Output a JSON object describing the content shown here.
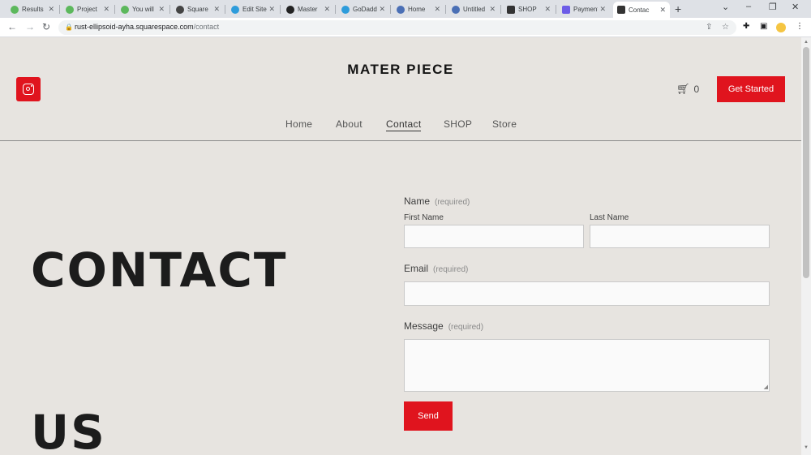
{
  "browser": {
    "tabs": [
      {
        "title": "Results",
        "favicon_color": "#5cb85c"
      },
      {
        "title": "Project",
        "favicon_color": "#5cb85c"
      },
      {
        "title": "You will",
        "favicon_color": "#5cb85c"
      },
      {
        "title": "Square",
        "favicon_color": "#444444"
      },
      {
        "title": "Edit Site",
        "favicon_color": "#2d9cdb"
      },
      {
        "title": "Master",
        "favicon_color": "#222222"
      },
      {
        "title": "GoDaddy",
        "favicon_color": "#2d9cdb"
      },
      {
        "title": "Home",
        "favicon_color": "#4a6fb5"
      },
      {
        "title": "Untitled",
        "favicon_color": "#4a6fb5"
      },
      {
        "title": "SHOP",
        "favicon_color": "#333333"
      },
      {
        "title": "Payment",
        "favicon_color": "#6c5ce7"
      },
      {
        "title": "Contac",
        "favicon_color": "#333333"
      }
    ],
    "active_tab_index": 11,
    "new_tab_label": "+",
    "url_host": "rust-ellipsoid-ayha.squarespace.com",
    "url_path": "/contact"
  },
  "site": {
    "title": "MATER PIECE",
    "cart_count": "0",
    "get_started_label": "Get Started",
    "nav": [
      {
        "label": "Home"
      },
      {
        "label": "About"
      },
      {
        "label": "Contact",
        "active": true
      },
      {
        "label": "SHOP"
      },
      {
        "label": "Store"
      }
    ],
    "accent_color": "#e0141e"
  },
  "hero": {
    "line1": "CONTACT",
    "line2": "US"
  },
  "form": {
    "name_label": "Name",
    "required_text": "(required)",
    "first_name_label": "First Name",
    "last_name_label": "Last Name",
    "email_label": "Email",
    "message_label": "Message",
    "first_name_value": "",
    "last_name_value": "",
    "email_value": "",
    "message_value": "",
    "send_label": "Send"
  }
}
